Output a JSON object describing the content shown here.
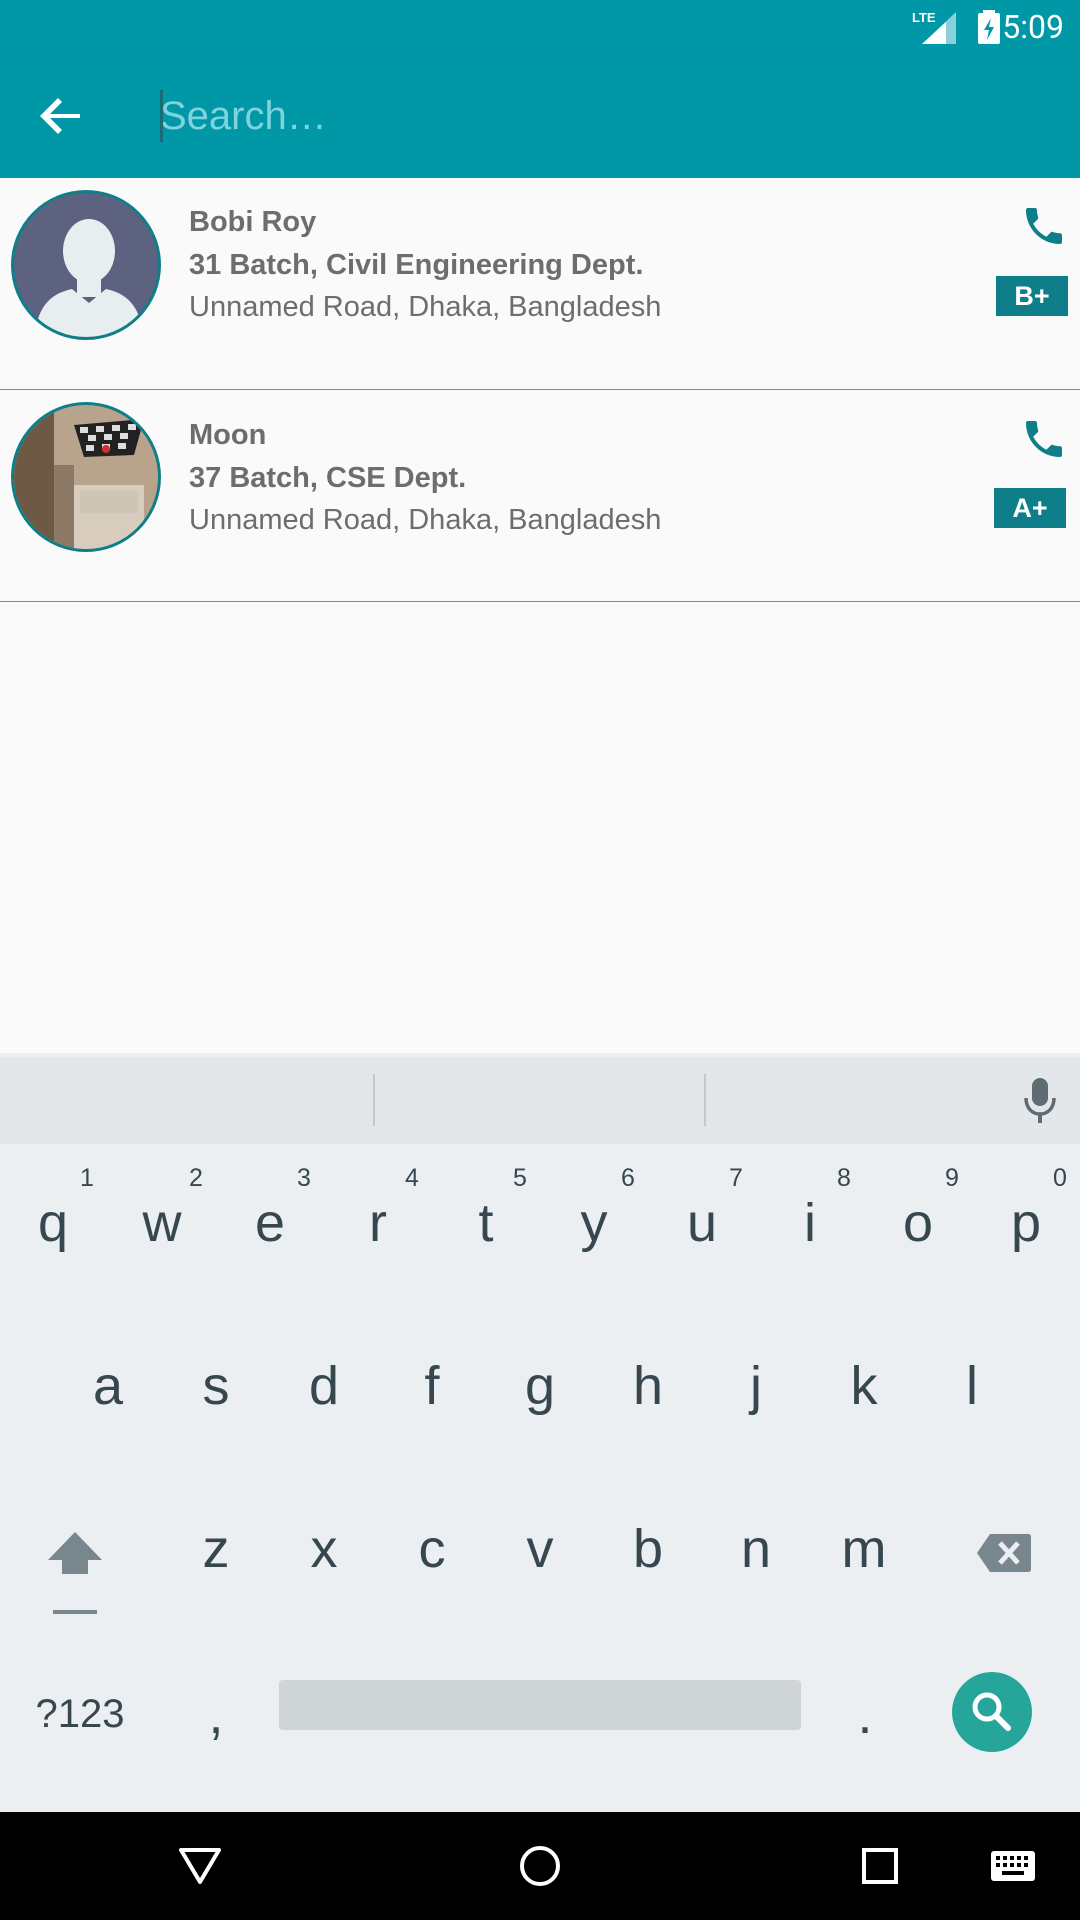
{
  "status_bar": {
    "time": "5:09",
    "network": "LTE",
    "icons": [
      "lte-signal-icon",
      "battery-charging-icon"
    ]
  },
  "toolbar": {
    "back_icon": "arrow-back-icon",
    "search_placeholder": "Search…",
    "search_value": ""
  },
  "contacts": [
    {
      "name": "Bobi Roy",
      "batch": "31 Batch, Civil Engineering Dept.",
      "address": "Unnamed Road, Dhaka, Bangladesh",
      "blood_group": "B+",
      "avatar": "default-person-avatar"
    },
    {
      "name": "Moon",
      "batch": "37 Batch, CSE Dept.",
      "address": "Unnamed Road, Dhaka, Bangladesh",
      "blood_group": "A+",
      "avatar": "photo-avatar"
    }
  ],
  "keyboard": {
    "row1": [
      "q",
      "w",
      "e",
      "r",
      "t",
      "y",
      "u",
      "i",
      "o",
      "p"
    ],
    "row1_hints": [
      "1",
      "2",
      "3",
      "4",
      "5",
      "6",
      "7",
      "8",
      "9",
      "0"
    ],
    "row2": [
      "a",
      "s",
      "d",
      "f",
      "g",
      "h",
      "j",
      "k",
      "l"
    ],
    "row3": [
      "z",
      "x",
      "c",
      "v",
      "b",
      "n",
      "m"
    ],
    "symbols_key": "?123",
    "comma": ",",
    "period": ".",
    "action_icon": "search-icon",
    "mic_icon": "microphone-icon"
  },
  "nav_bar": {
    "icons": [
      "back-triangle-icon",
      "home-circle-icon",
      "recents-square-icon",
      "keyboard-icon"
    ]
  },
  "colors": {
    "primary": "#0097a7",
    "accent_dark": "#0e7f88",
    "keyboard_bg": "#eceff1",
    "fab": "#26a69a"
  }
}
